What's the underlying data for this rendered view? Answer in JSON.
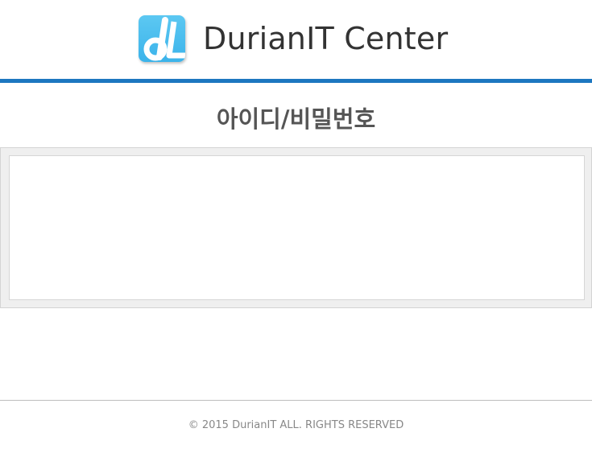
{
  "header": {
    "site_title": "DurianIT Center",
    "logo_icon": "durianit-logo-icon",
    "brand_color": "#1d77c0",
    "logo_color": "#3bb3ea"
  },
  "main": {
    "page_title": "아이디/비밀번호"
  },
  "footer": {
    "copyright": "© 2015 DurianIT ALL. RIGHTS RESERVED"
  }
}
